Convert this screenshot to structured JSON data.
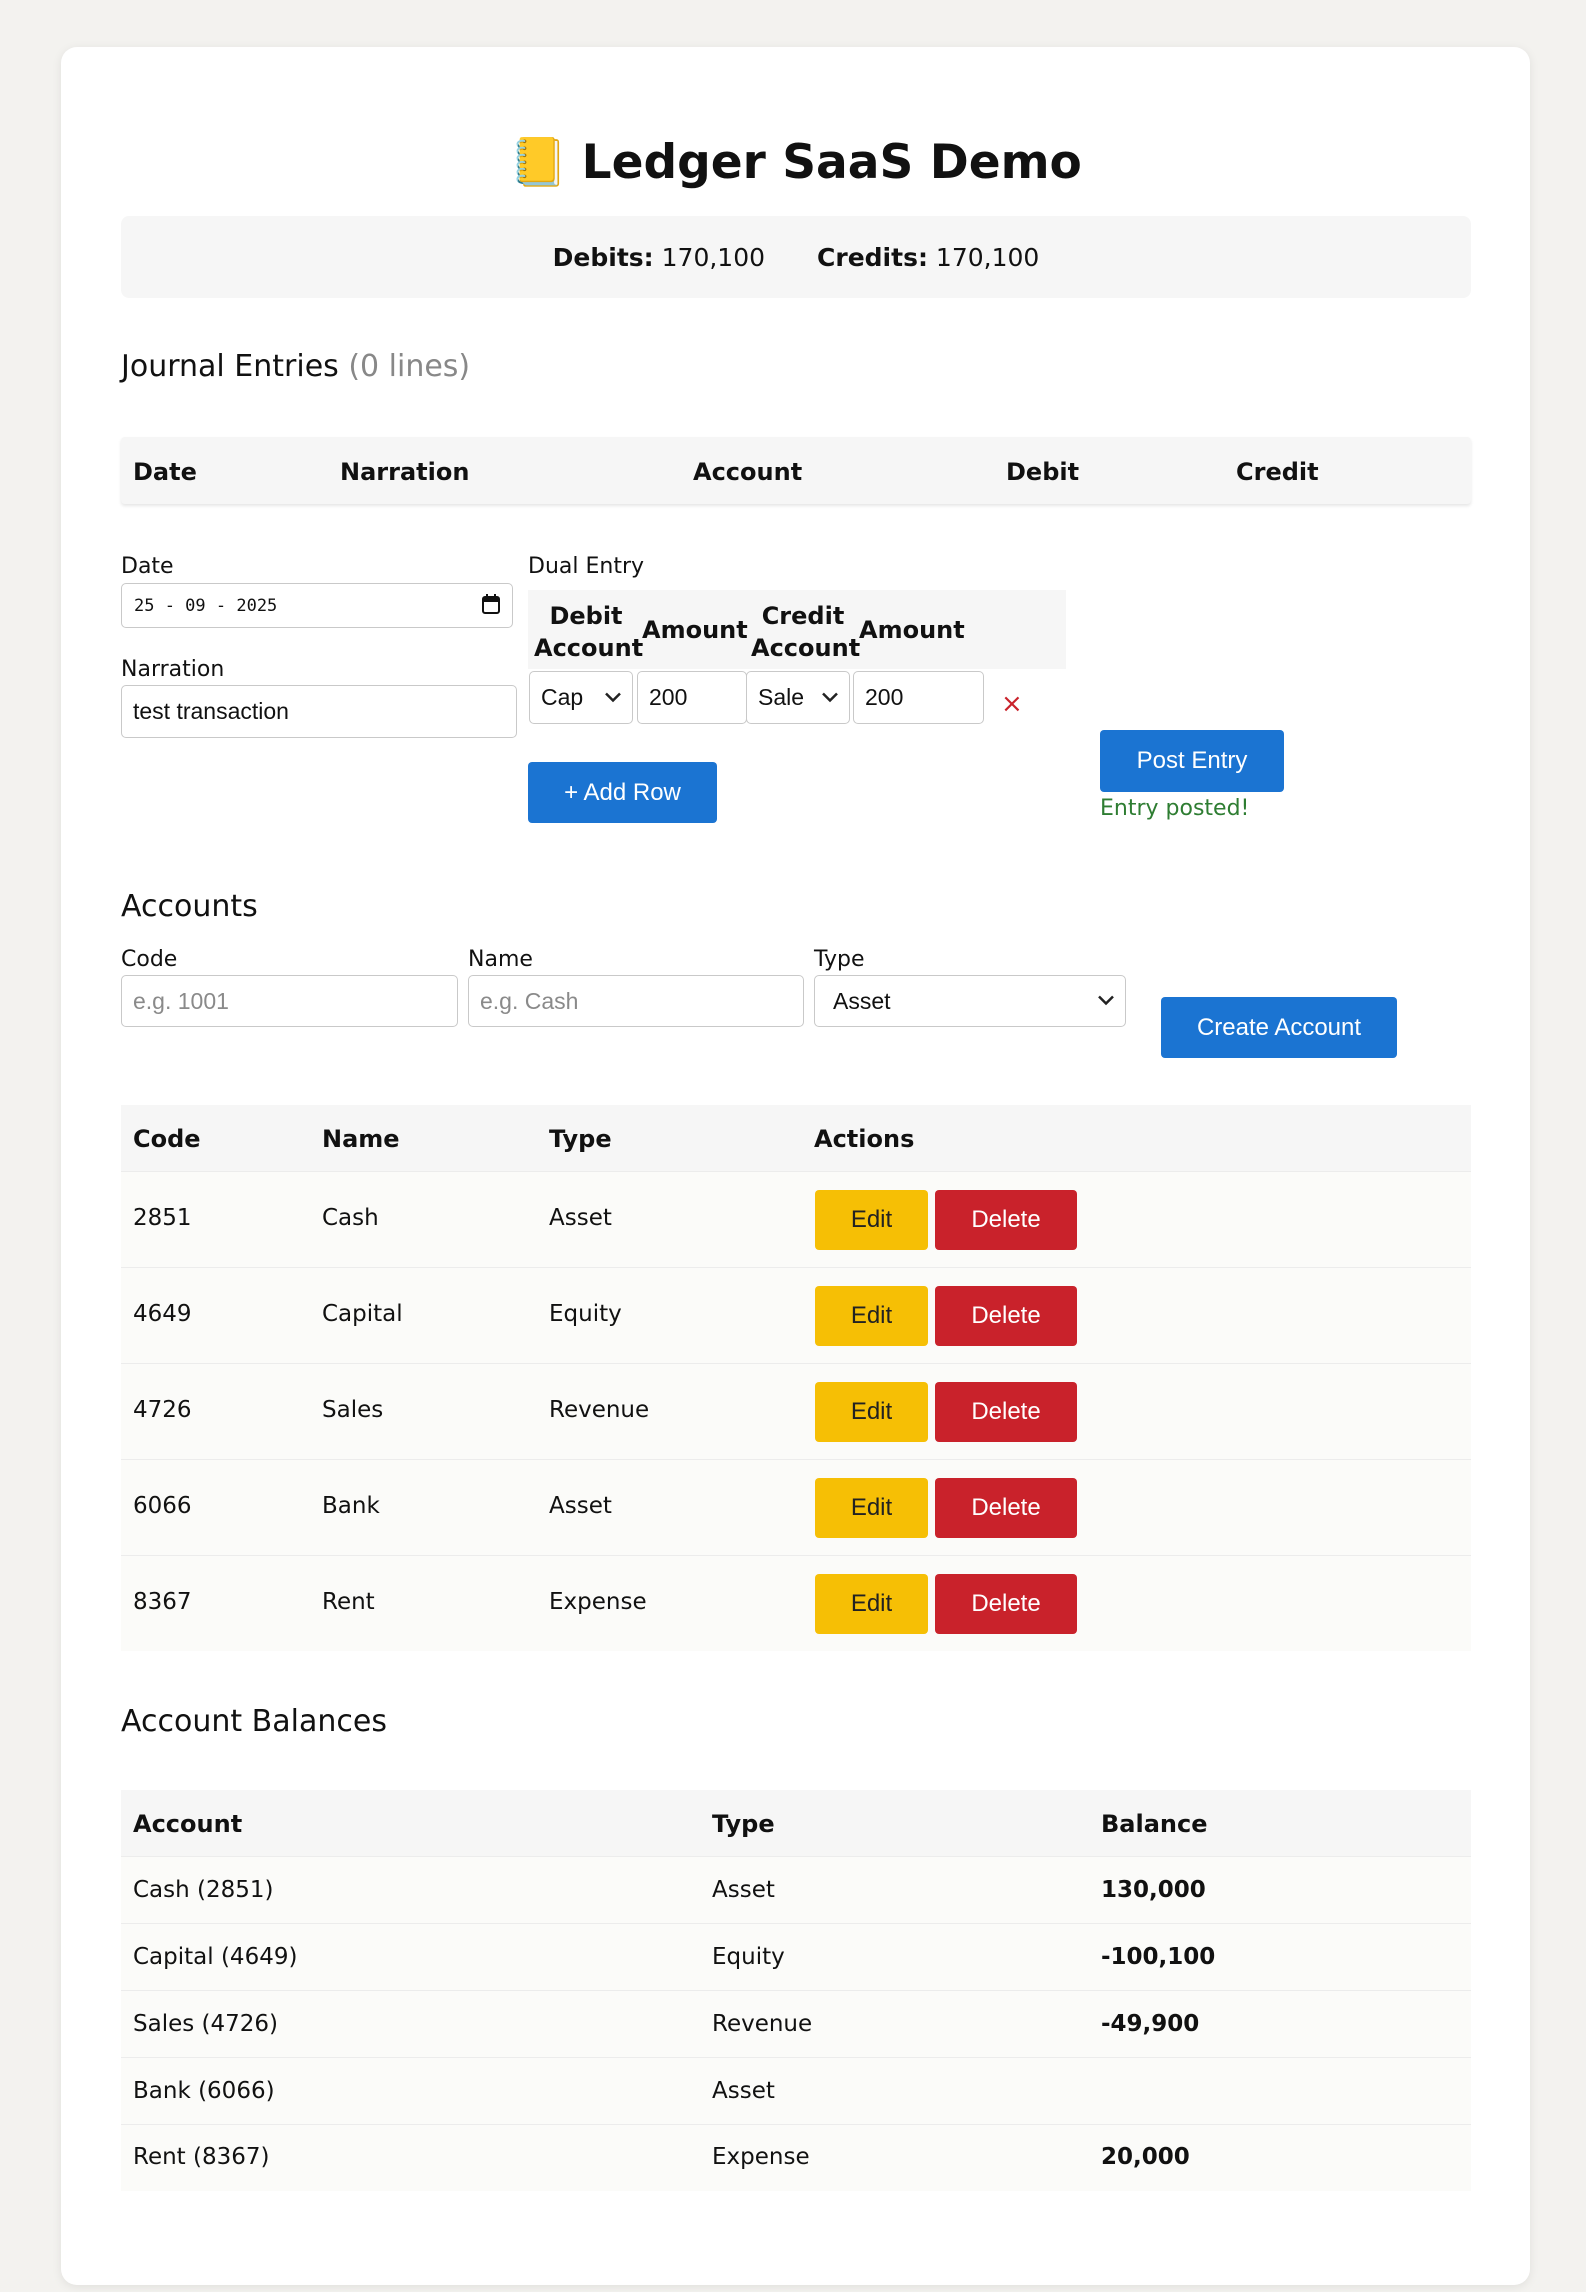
{
  "app": {
    "title": "Ledger SaaS Demo",
    "title_emoji": "📒"
  },
  "summary": {
    "debits_label": "Debits:",
    "debits_value": "170,100",
    "credits_label": "Credits:",
    "credits_value": "170,100"
  },
  "journal": {
    "heading": "Journal Entries",
    "count": "(0 lines)",
    "columns": [
      "Date",
      "Narration",
      "Account",
      "Debit",
      "Credit"
    ]
  },
  "entry_form": {
    "date_label": "Date",
    "date_value": "25 - 09 - 2025",
    "narration_label": "Narration",
    "narration_value": "test transaction",
    "dual_entry_label": "Dual Entry",
    "dual_cols": {
      "debit_account_l1": "Debit",
      "debit_account_l2": "Account",
      "amount1": "Amount",
      "credit_account_l1": "Credit",
      "credit_account_l2": "Account",
      "amount2": "Amount"
    },
    "row": {
      "debit_account": "Cap",
      "debit_amount": "200",
      "credit_account": "Sale",
      "credit_amount": "200",
      "remove_glyph": "×"
    },
    "add_row_label": "+ Add Row",
    "post_label": "Post Entry",
    "status": "Entry posted!",
    "status_color": "#2e7d32"
  },
  "accounts": {
    "heading": "Accounts",
    "code_label": "Code",
    "code_placeholder": "e.g. 1001",
    "name_label": "Name",
    "name_placeholder": "e.g. Cash",
    "type_label": "Type",
    "type_value": "Asset",
    "create_label": "Create Account",
    "columns": [
      "Code",
      "Name",
      "Type",
      "Actions"
    ],
    "edit_label": "Edit",
    "delete_label": "Delete",
    "rows": [
      {
        "code": "2851",
        "name": "Cash",
        "type": "Asset"
      },
      {
        "code": "4649",
        "name": "Capital",
        "type": "Equity"
      },
      {
        "code": "4726",
        "name": "Sales",
        "type": "Revenue"
      },
      {
        "code": "6066",
        "name": "Bank",
        "type": "Asset"
      },
      {
        "code": "8367",
        "name": "Rent",
        "type": "Expense"
      }
    ]
  },
  "balances": {
    "heading": "Account Balances",
    "columns": [
      "Account",
      "Type",
      "Balance"
    ],
    "rows": [
      {
        "account": "Cash (2851)",
        "type": "Asset",
        "balance": "130,000"
      },
      {
        "account": "Capital (4649)",
        "type": "Equity",
        "balance": "-100,100"
      },
      {
        "account": "Sales (4726)",
        "type": "Revenue",
        "balance": "-49,900"
      },
      {
        "account": "Bank (6066)",
        "type": "Asset",
        "balance": ""
      },
      {
        "account": "Rent (8367)",
        "type": "Expense",
        "balance": "20,000"
      }
    ]
  },
  "colors": {
    "primary": "#1b74d2",
    "edit": "#f6bf05",
    "delete": "#c9222b",
    "remove": "#c9222b"
  }
}
